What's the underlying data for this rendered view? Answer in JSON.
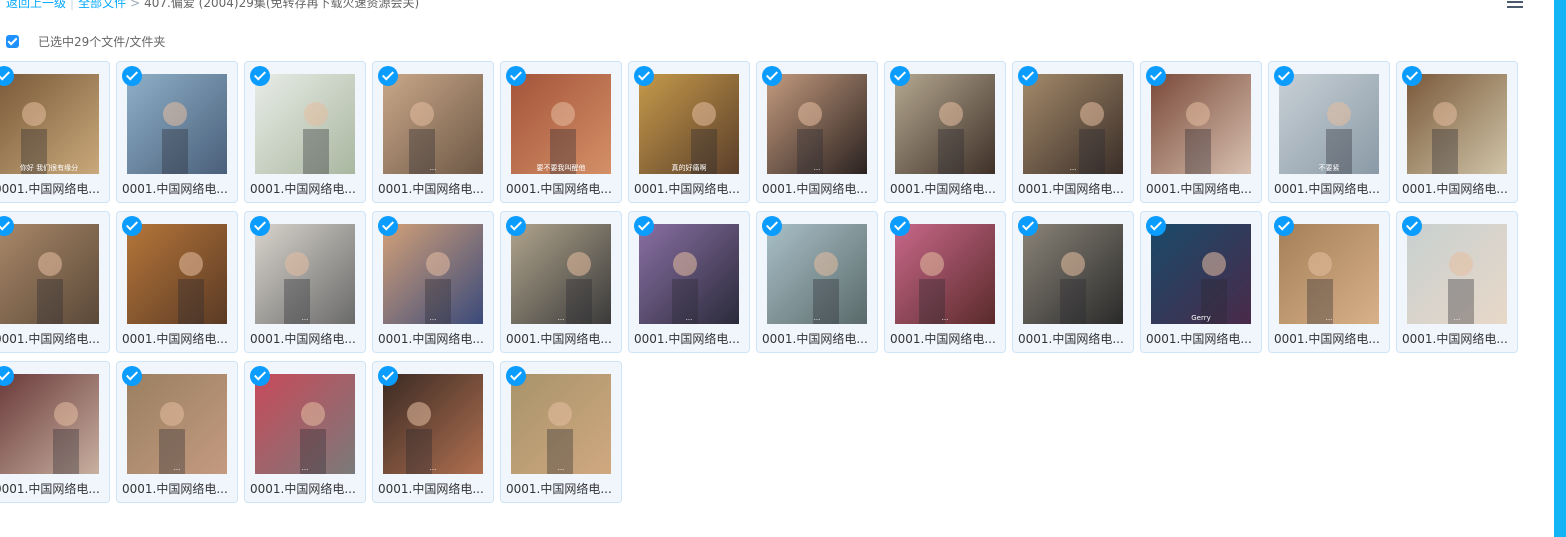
{
  "breadcrumb": {
    "back": "返回上一级",
    "all_files": "全部文件",
    "current": "407.偏爱 (2004)29集(免转存再下载火速资源会关)"
  },
  "selection": {
    "text": "已选中29个文件/文件夹"
  },
  "files": [
    {
      "name": "0001.中国网络电...",
      "checked": true,
      "colors": [
        "#7a5a3a",
        "#c9a97a"
      ],
      "caption": "你好 我们很有缘分"
    },
    {
      "name": "0001.中国网络电...",
      "checked": true,
      "colors": [
        "#8fb0c8",
        "#4a5f7a"
      ],
      "caption": ""
    },
    {
      "name": "0001.中国网络电...",
      "checked": true,
      "colors": [
        "#e8ece6",
        "#a9b7a0"
      ],
      "caption": ""
    },
    {
      "name": "0001.中国网络电...",
      "checked": true,
      "colors": [
        "#caa889",
        "#6d5846"
      ],
      "caption": "..."
    },
    {
      "name": "0001.中国网络电...",
      "checked": true,
      "colors": [
        "#a4543a",
        "#d49067"
      ],
      "caption": "要不要我叫醒他"
    },
    {
      "name": "0001.中国网络电...",
      "checked": true,
      "colors": [
        "#c69a4a",
        "#5a3e2a"
      ],
      "caption": "真的好痛啊"
    },
    {
      "name": "0001.中国网络电...",
      "checked": true,
      "colors": [
        "#c49a7e",
        "#2a2220"
      ],
      "caption": "..."
    },
    {
      "name": "0001.中国网络电...",
      "checked": true,
      "colors": [
        "#b5a890",
        "#3e3028"
      ],
      "caption": ""
    },
    {
      "name": "0001.中国网络电...",
      "checked": true,
      "colors": [
        "#a48a6a",
        "#3a2e28"
      ],
      "caption": "..."
    },
    {
      "name": "0001.中国网络电...",
      "checked": true,
      "colors": [
        "#7a4a3a",
        "#d8c0b0"
      ],
      "caption": ""
    },
    {
      "name": "0001.中国网络电...",
      "checked": true,
      "colors": [
        "#c8d0d6",
        "#8a9aa6"
      ],
      "caption": "不要紧"
    },
    {
      "name": "0001.中国网络电...",
      "checked": true,
      "colors": [
        "#7a5a3a",
        "#d0c4a8"
      ],
      "caption": ""
    },
    {
      "name": "0001.中国网络电...",
      "checked": true,
      "colors": [
        "#a98868",
        "#5a4838"
      ],
      "caption": ""
    },
    {
      "name": "0001.中国网络电...",
      "checked": true,
      "colors": [
        "#b6763a",
        "#5a3a24"
      ],
      "caption": ""
    },
    {
      "name": "0001.中国网络电...",
      "checked": true,
      "colors": [
        "#d8d4cc",
        "#6a6a6a"
      ],
      "caption": "..."
    },
    {
      "name": "0001.中国网络电...",
      "checked": true,
      "colors": [
        "#d2a078",
        "#3a4a7a"
      ],
      "caption": "..."
    },
    {
      "name": "0001.中国网络电...",
      "checked": true,
      "colors": [
        "#b0a48c",
        "#3a3a3a"
      ],
      "caption": "..."
    },
    {
      "name": "0001.中国网络电...",
      "checked": true,
      "colors": [
        "#8a70a4",
        "#2a2a3a"
      ],
      "caption": "..."
    },
    {
      "name": "0001.中国网络电...",
      "checked": true,
      "colors": [
        "#a9c0c8",
        "#5a6a6a"
      ],
      "caption": "..."
    },
    {
      "name": "0001.中国网络电...",
      "checked": true,
      "colors": [
        "#c8688a",
        "#5a2a2a"
      ],
      "caption": "..."
    },
    {
      "name": "0001.中国网络电...",
      "checked": true,
      "colors": [
        "#8a8478",
        "#2a2a2a"
      ],
      "caption": ""
    },
    {
      "name": "0001.中国网络电...",
      "checked": true,
      "colors": [
        "#1a4a6a",
        "#4a2a4a"
      ],
      "caption": "Gerry"
    },
    {
      "name": "0001.中国网络电...",
      "checked": true,
      "colors": [
        "#a48058",
        "#d8b08a"
      ],
      "caption": "..."
    },
    {
      "name": "0001.中国网络电...",
      "checked": true,
      "colors": [
        "#c8d0d0",
        "#e8d8c8"
      ],
      "caption": "..."
    },
    {
      "name": "0001.中国网络电...",
      "checked": true,
      "colors": [
        "#6a3a3a",
        "#c8b0a0"
      ],
      "caption": ""
    },
    {
      "name": "0001.中国网络电...",
      "checked": true,
      "colors": [
        "#9a8060",
        "#c49a80"
      ],
      "caption": "..."
    },
    {
      "name": "0001.中国网络电...",
      "checked": true,
      "colors": [
        "#c84a5a",
        "#7a7a7a"
      ],
      "caption": "..."
    },
    {
      "name": "0001.中国网络电...",
      "checked": true,
      "colors": [
        "#3a2a24",
        "#b07050"
      ],
      "caption": "..."
    },
    {
      "name": "0001.中国网络电...",
      "checked": true,
      "colors": [
        "#a8946a",
        "#d0a880"
      ],
      "caption": "..."
    }
  ]
}
